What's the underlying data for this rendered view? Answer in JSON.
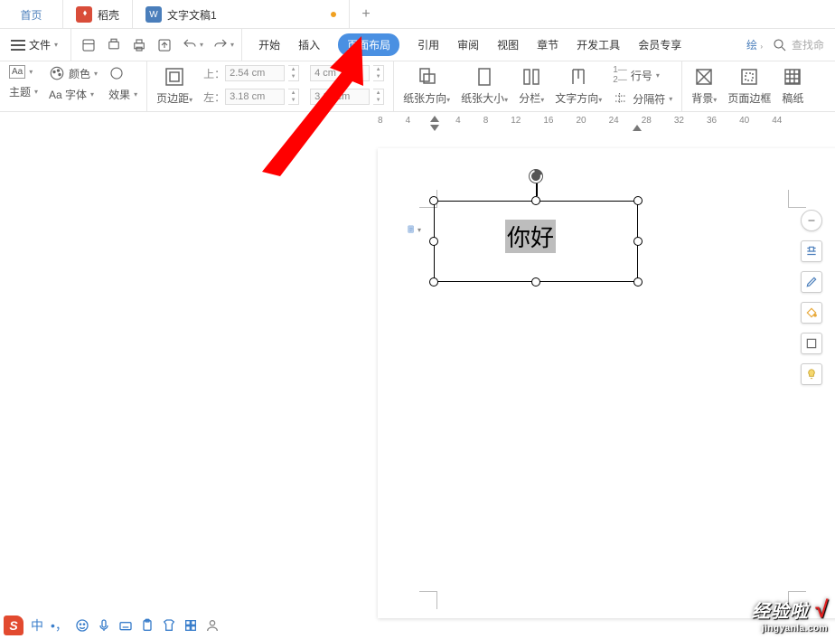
{
  "tabs": {
    "home": "首页",
    "docshell": "稻壳",
    "doc": "文字文稿1",
    "plus": "+"
  },
  "menu": {
    "file": "文件",
    "search_placeholder": "查找命",
    "right_tool": "绘"
  },
  "ribbon_tabs": {
    "start": "开始",
    "insert": "插入",
    "layout": "页面布局",
    "reference": "引用",
    "review": "审阅",
    "view": "视图",
    "chapter": "章节",
    "dev": "开发工具",
    "member": "会员专享"
  },
  "ribbon": {
    "theme": "主题",
    "color": "颜色",
    "font": "Aa 字体",
    "effect": "效果",
    "margin": "页边距",
    "top_lbl": "上：",
    "left_lbl": "左：",
    "top_val": "2.54 cm",
    "left_val": "3.18 cm",
    "right_top_val": "4 cm",
    "right_bot_val": "3.18 cm",
    "orient": "纸张方向",
    "size": "纸张大小",
    "columns": "分栏",
    "textdir": "文字方向",
    "linenum": "行号",
    "break": "分隔符",
    "bg": "背景",
    "border": "页面边框",
    "paper": "稿纸"
  },
  "ruler": [
    "8",
    "4",
    "",
    "4",
    "8",
    "12",
    "16",
    "20",
    "24",
    "28",
    "32",
    "36",
    "40",
    "44"
  ],
  "textbox": {
    "text": "你好"
  },
  "ime": {
    "lang": "中"
  },
  "watermark": {
    "line1": "经验啦",
    "check": "√",
    "line2": "jingyanla.com"
  }
}
